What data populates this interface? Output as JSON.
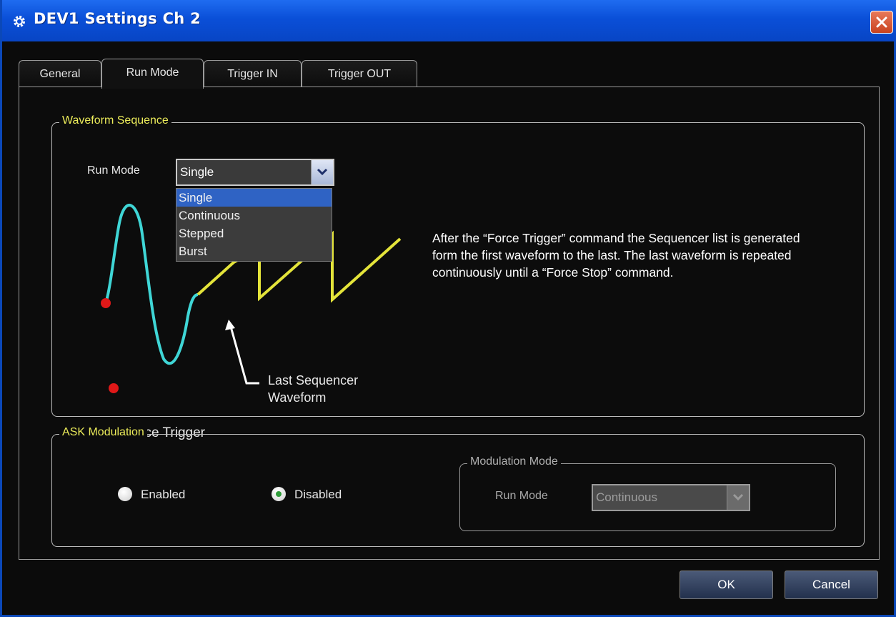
{
  "window": {
    "title": "DEV1 Settings Ch 2"
  },
  "tabs": [
    "General",
    "Run Mode",
    "Trigger IN",
    "Trigger OUT"
  ],
  "active_tab": "Run Mode",
  "waveform_sequence": {
    "group_label": "Waveform Sequence",
    "run_mode_label": "Run Mode",
    "run_mode_value": "Single",
    "options": [
      "Single",
      "Continuous",
      "Stepped",
      "Burst"
    ],
    "selected_option": "Single",
    "diagram": {
      "last_label_line1": "Last Sequencer",
      "last_label_line2": "Waveform",
      "legend": "Force Trigger"
    },
    "description": "After the “Force Trigger” command the Sequencer list is generated form the first waveform to the last. The last waveform is repeated continuously until a “Force Stop” command."
  },
  "ask_modulation": {
    "group_label": "ASK Modulation",
    "enabled_label": "Enabled",
    "disabled_label": "Disabled",
    "selected": "Disabled",
    "modulation_mode": {
      "group_label": "Modulation Mode",
      "run_mode_label": "Run Mode",
      "run_mode_value": "Continuous"
    }
  },
  "buttons": {
    "ok": "OK",
    "cancel": "Cancel"
  },
  "colors": {
    "title_bar": "#0a4fd8",
    "group_label": "#ecec5a",
    "wave_cyan": "#3fd6d6",
    "wave_yellow": "#e4e43a",
    "trigger_dot": "#e01818",
    "selected_option": "#2f63c4"
  }
}
